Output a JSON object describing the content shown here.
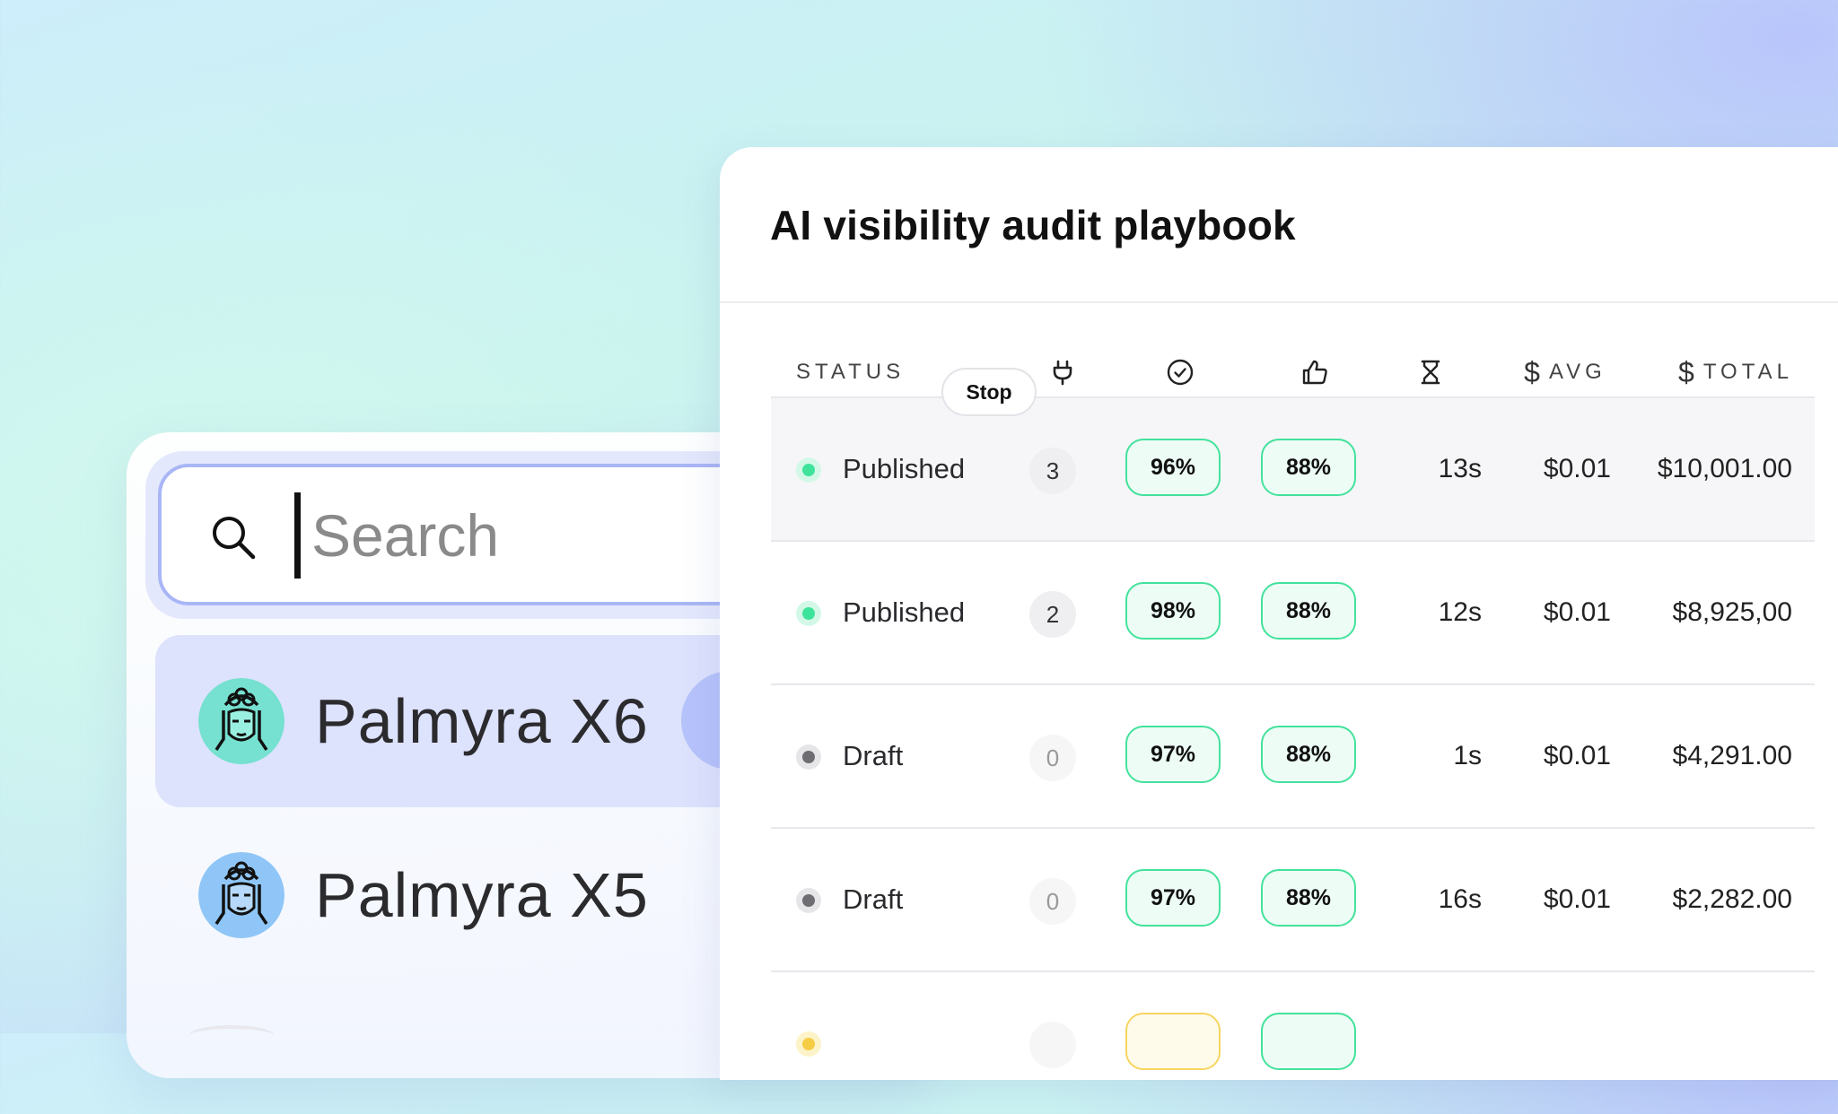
{
  "picker": {
    "search": {
      "placeholder": "Search",
      "value": ""
    },
    "models": [
      {
        "name": "Palmyra X6",
        "selected": true,
        "avatar_bg": "#76e1d0"
      },
      {
        "name": "Palmyra X5",
        "selected": false,
        "avatar_bg": "#8fc6f7"
      }
    ]
  },
  "table": {
    "title": "AI visibility audit playbook",
    "headers": {
      "status": "STATUS",
      "plug_icon": "plug-icon",
      "check_icon": "check-circle-icon",
      "thumb_icon": "thumbs-up-icon",
      "hourglass_icon": "hourglass-icon",
      "avg_symbol": "$",
      "avg": "AVG",
      "total_symbol": "$",
      "total": "TOTAL"
    },
    "tooltip": "Stop",
    "rows": [
      {
        "status": "Published",
        "count": "3",
        "check": "96%",
        "thumbs": "88%",
        "time": "13s",
        "avg": "$0.01",
        "total": "$10,001.00"
      },
      {
        "status": "Published",
        "count": "2",
        "check": "98%",
        "thumbs": "88%",
        "time": "12s",
        "avg": "$0.01",
        "total": "$8,925,00"
      },
      {
        "status": "Draft",
        "count": "0",
        "check": "97%",
        "thumbs": "88%",
        "time": "1s",
        "avg": "$0.01",
        "total": "$4,291.00"
      },
      {
        "status": "Draft",
        "count": "0",
        "check": "97%",
        "thumbs": "88%",
        "time": "16s",
        "avg": "$0.01",
        "total": "$2,282.00"
      }
    ]
  },
  "colors": {
    "published": "#3ee39b",
    "draft": "#6e6e72",
    "pill_border": "#43e29c",
    "selection": "#dde2fd",
    "search_border": "#a9b6f6"
  }
}
